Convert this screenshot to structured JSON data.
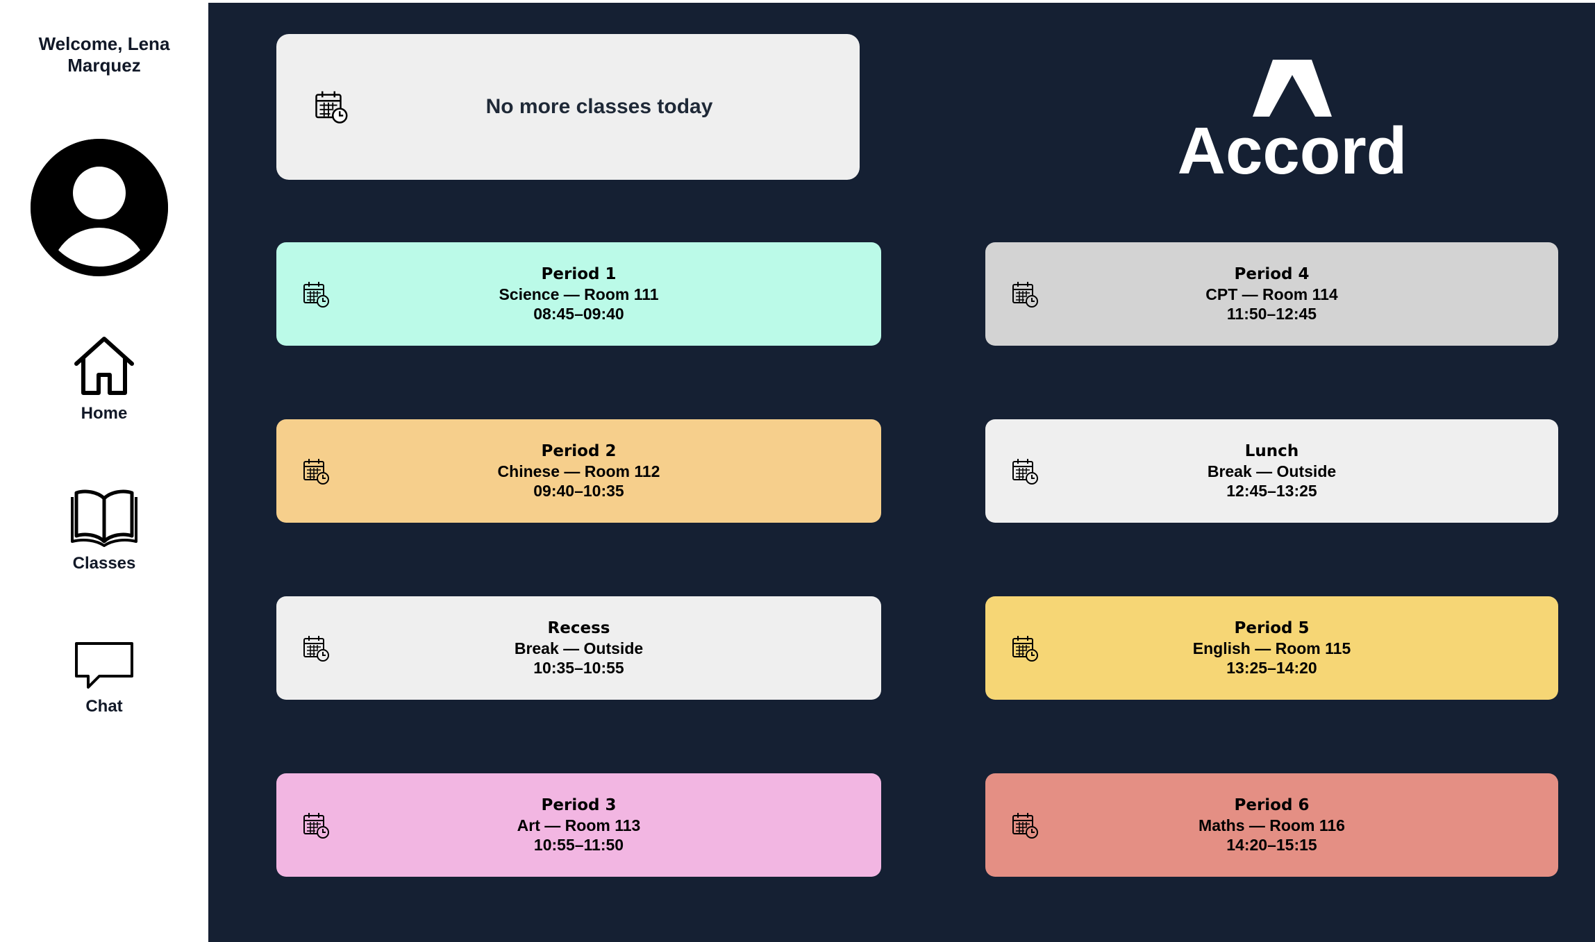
{
  "sidebar": {
    "welcome_line1": "Welcome, Lena",
    "welcome_line2": "Marquez",
    "nav": [
      {
        "label": "Home",
        "icon": "home-icon"
      },
      {
        "label": "Classes",
        "icon": "book-icon"
      },
      {
        "label": "Chat",
        "icon": "chat-bubble-icon"
      }
    ]
  },
  "banner": {
    "text": "No more classes today",
    "icon": "calendar-clock-icon"
  },
  "logo": {
    "text": "Accord"
  },
  "schedule": [
    {
      "title": "Period 1",
      "subtitle": "Science — Room 111",
      "time": "08:45–09:40",
      "color": "#bbfae8"
    },
    {
      "title": "Period 2",
      "subtitle": "Chinese — Room 112",
      "time": "09:40–10:35",
      "color": "#f6cf8c"
    },
    {
      "title": "Recess",
      "subtitle": "Break — Outside",
      "time": "10:35–10:55",
      "color": "#efefef"
    },
    {
      "title": "Period 3",
      "subtitle": "Art — Room 113",
      "time": "10:55–11:50",
      "color": "#f2b6e2"
    },
    {
      "title": "Period 4",
      "subtitle": "CPT — Room 114",
      "time": "11:50–12:45",
      "color": "#d3d3d3"
    },
    {
      "title": "Lunch",
      "subtitle": "Break — Outside",
      "time": "12:45–13:25",
      "color": "#efefef"
    },
    {
      "title": "Period 5",
      "subtitle": "English — Room 115",
      "time": "13:25–14:20",
      "color": "#f6d675"
    },
    {
      "title": "Period 6",
      "subtitle": "Maths — Room 116",
      "time": "14:20–15:15",
      "color": "#e48f84"
    }
  ],
  "colors": {
    "main_bg": "#152033",
    "sidebar_bg": "#ffffff",
    "banner_bg": "#efefef"
  }
}
